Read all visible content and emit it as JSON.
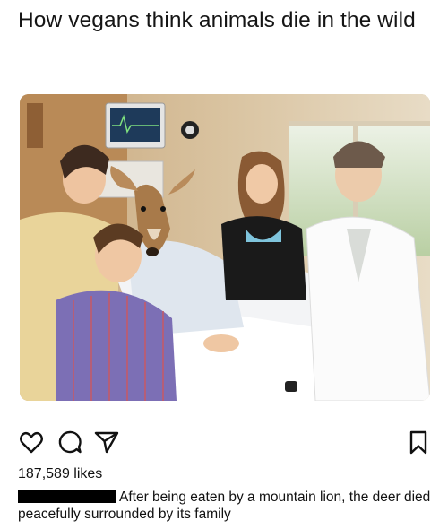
{
  "post": {
    "title": "How vegans think animals die in the wild"
  },
  "photo": {
    "description_icon": "deer-hospital-photo"
  },
  "actions": {
    "like_icon": "heart-icon",
    "comment_icon": "comment-icon",
    "share_icon": "send-icon",
    "save_icon": "bookmark-icon"
  },
  "likes": {
    "count_text": "187,589 likes"
  },
  "caption": {
    "text": "After being eaten by a mountain lion, the deer died peacefully surrounded by its family"
  },
  "colors": {
    "text": "#111111",
    "redaction": "#000000"
  }
}
